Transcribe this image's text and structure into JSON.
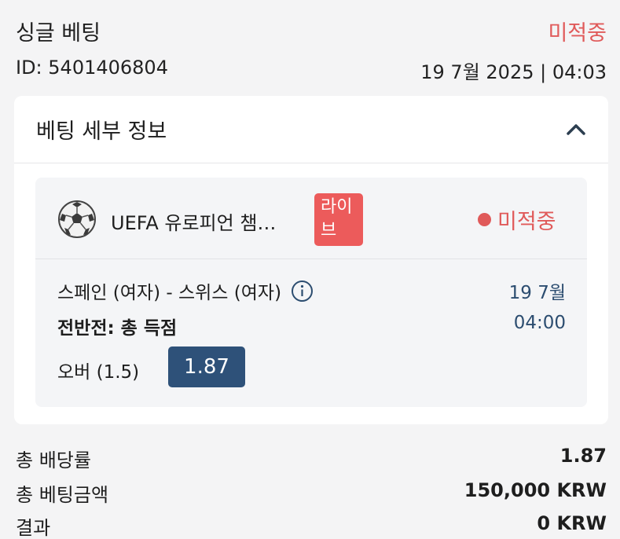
{
  "header": {
    "title": "싱글 베팅",
    "status": "미적중",
    "bet_id": "ID: 5401406804",
    "datetime": "19 7월 2025 | 04:03"
  },
  "details": {
    "title": "베팅 세부 정보",
    "toggle_icon": "chevron-up-icon",
    "event": {
      "sport_icon": "soccer-ball-icon",
      "league": "UEFA 유로피언 챔…",
      "live_badge": "라이\n브",
      "status": "미적중",
      "match": "스페인 (여자) - 스위스 (여자)",
      "info_icon": "info-icon",
      "date": "19 7월",
      "time": "04:00",
      "market": "전반전: 총 득점",
      "selection": "오버 (1.5)",
      "odds": "1.87"
    }
  },
  "summary": {
    "total_odds_label": "총 배당률",
    "total_odds_value": "1.87",
    "total_stake_label": "총 베팅금액",
    "total_stake_value": "150,000 KRW",
    "result_label": "결과",
    "result_value": "0 KRW"
  },
  "colors": {
    "lost": "#e05a5a",
    "live_badge": "#ec5b5b",
    "odds_button": "#2e5179",
    "date_text": "#2c4d70"
  }
}
